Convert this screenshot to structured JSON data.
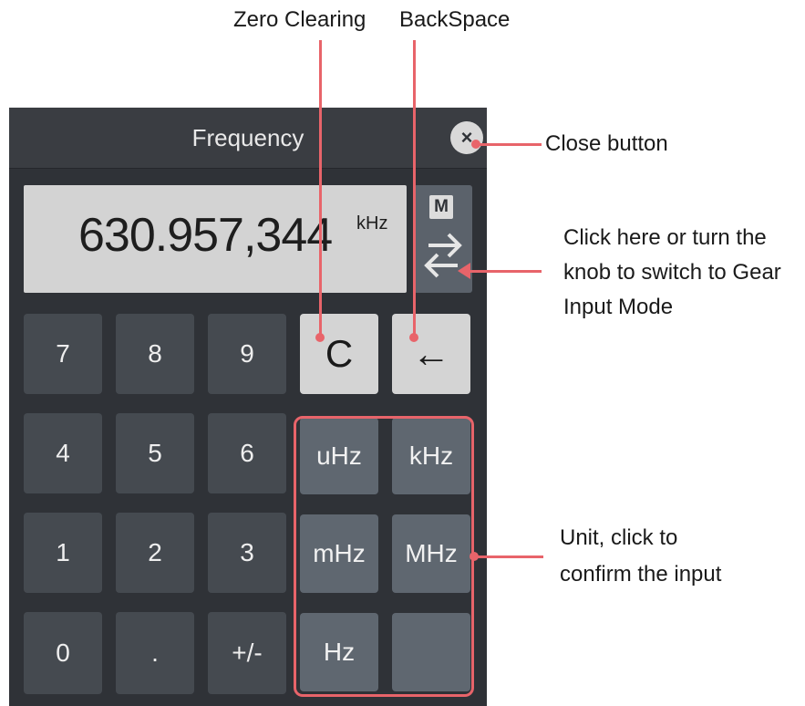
{
  "dialog": {
    "title": "Frequency",
    "close_glyph": "×",
    "display_value": "630.957,344",
    "display_unit": "kHz",
    "mode_label": "M",
    "mode_icon": "swap-arrows-icon"
  },
  "keypad": {
    "k7": "7",
    "k8": "8",
    "k9": "9",
    "clear": "C",
    "backspace": "←",
    "k4": "4",
    "k5": "5",
    "k6": "6",
    "uhz": "uHz",
    "khz": "kHz",
    "k1": "1",
    "k2": "2",
    "k3": "3",
    "mhz_milli": "mHz",
    "mhz_mega": "MHz",
    "k0": "0",
    "dot": ".",
    "sign": "+/-",
    "hz": "Hz",
    "blank": ""
  },
  "annotations": {
    "zero_clearing": "Zero Clearing",
    "backspace": "BackSpace",
    "close_button": "Close button",
    "mode_line1": "Click here or turn the",
    "mode_line2": "knob to switch to Gear",
    "mode_line3": "Input Mode",
    "unit_line1": "Unit, click to",
    "unit_line2": "confirm the input"
  },
  "colors": {
    "panel": "#2f3237",
    "key_dark": "#454a50",
    "key_unit": "#5f6770",
    "key_light": "#d4d4d4",
    "annotation": "#e8646a"
  }
}
